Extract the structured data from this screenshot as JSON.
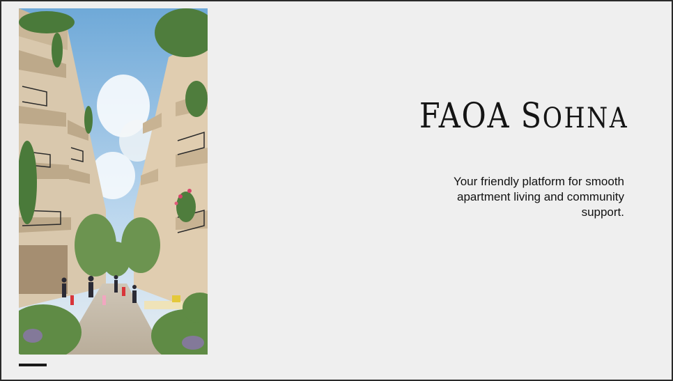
{
  "slide": {
    "title_main": "FAOA S",
    "title_smallcaps": "OHNA",
    "subtitle": "Your friendly platform for smooth apartment living and community support."
  },
  "photo": {
    "subject": "apartment-courtyard-photo"
  },
  "colors": {
    "background": "#efefef",
    "border": "#2a2a2a",
    "text": "#141414",
    "accent": "#1a1a1a"
  }
}
